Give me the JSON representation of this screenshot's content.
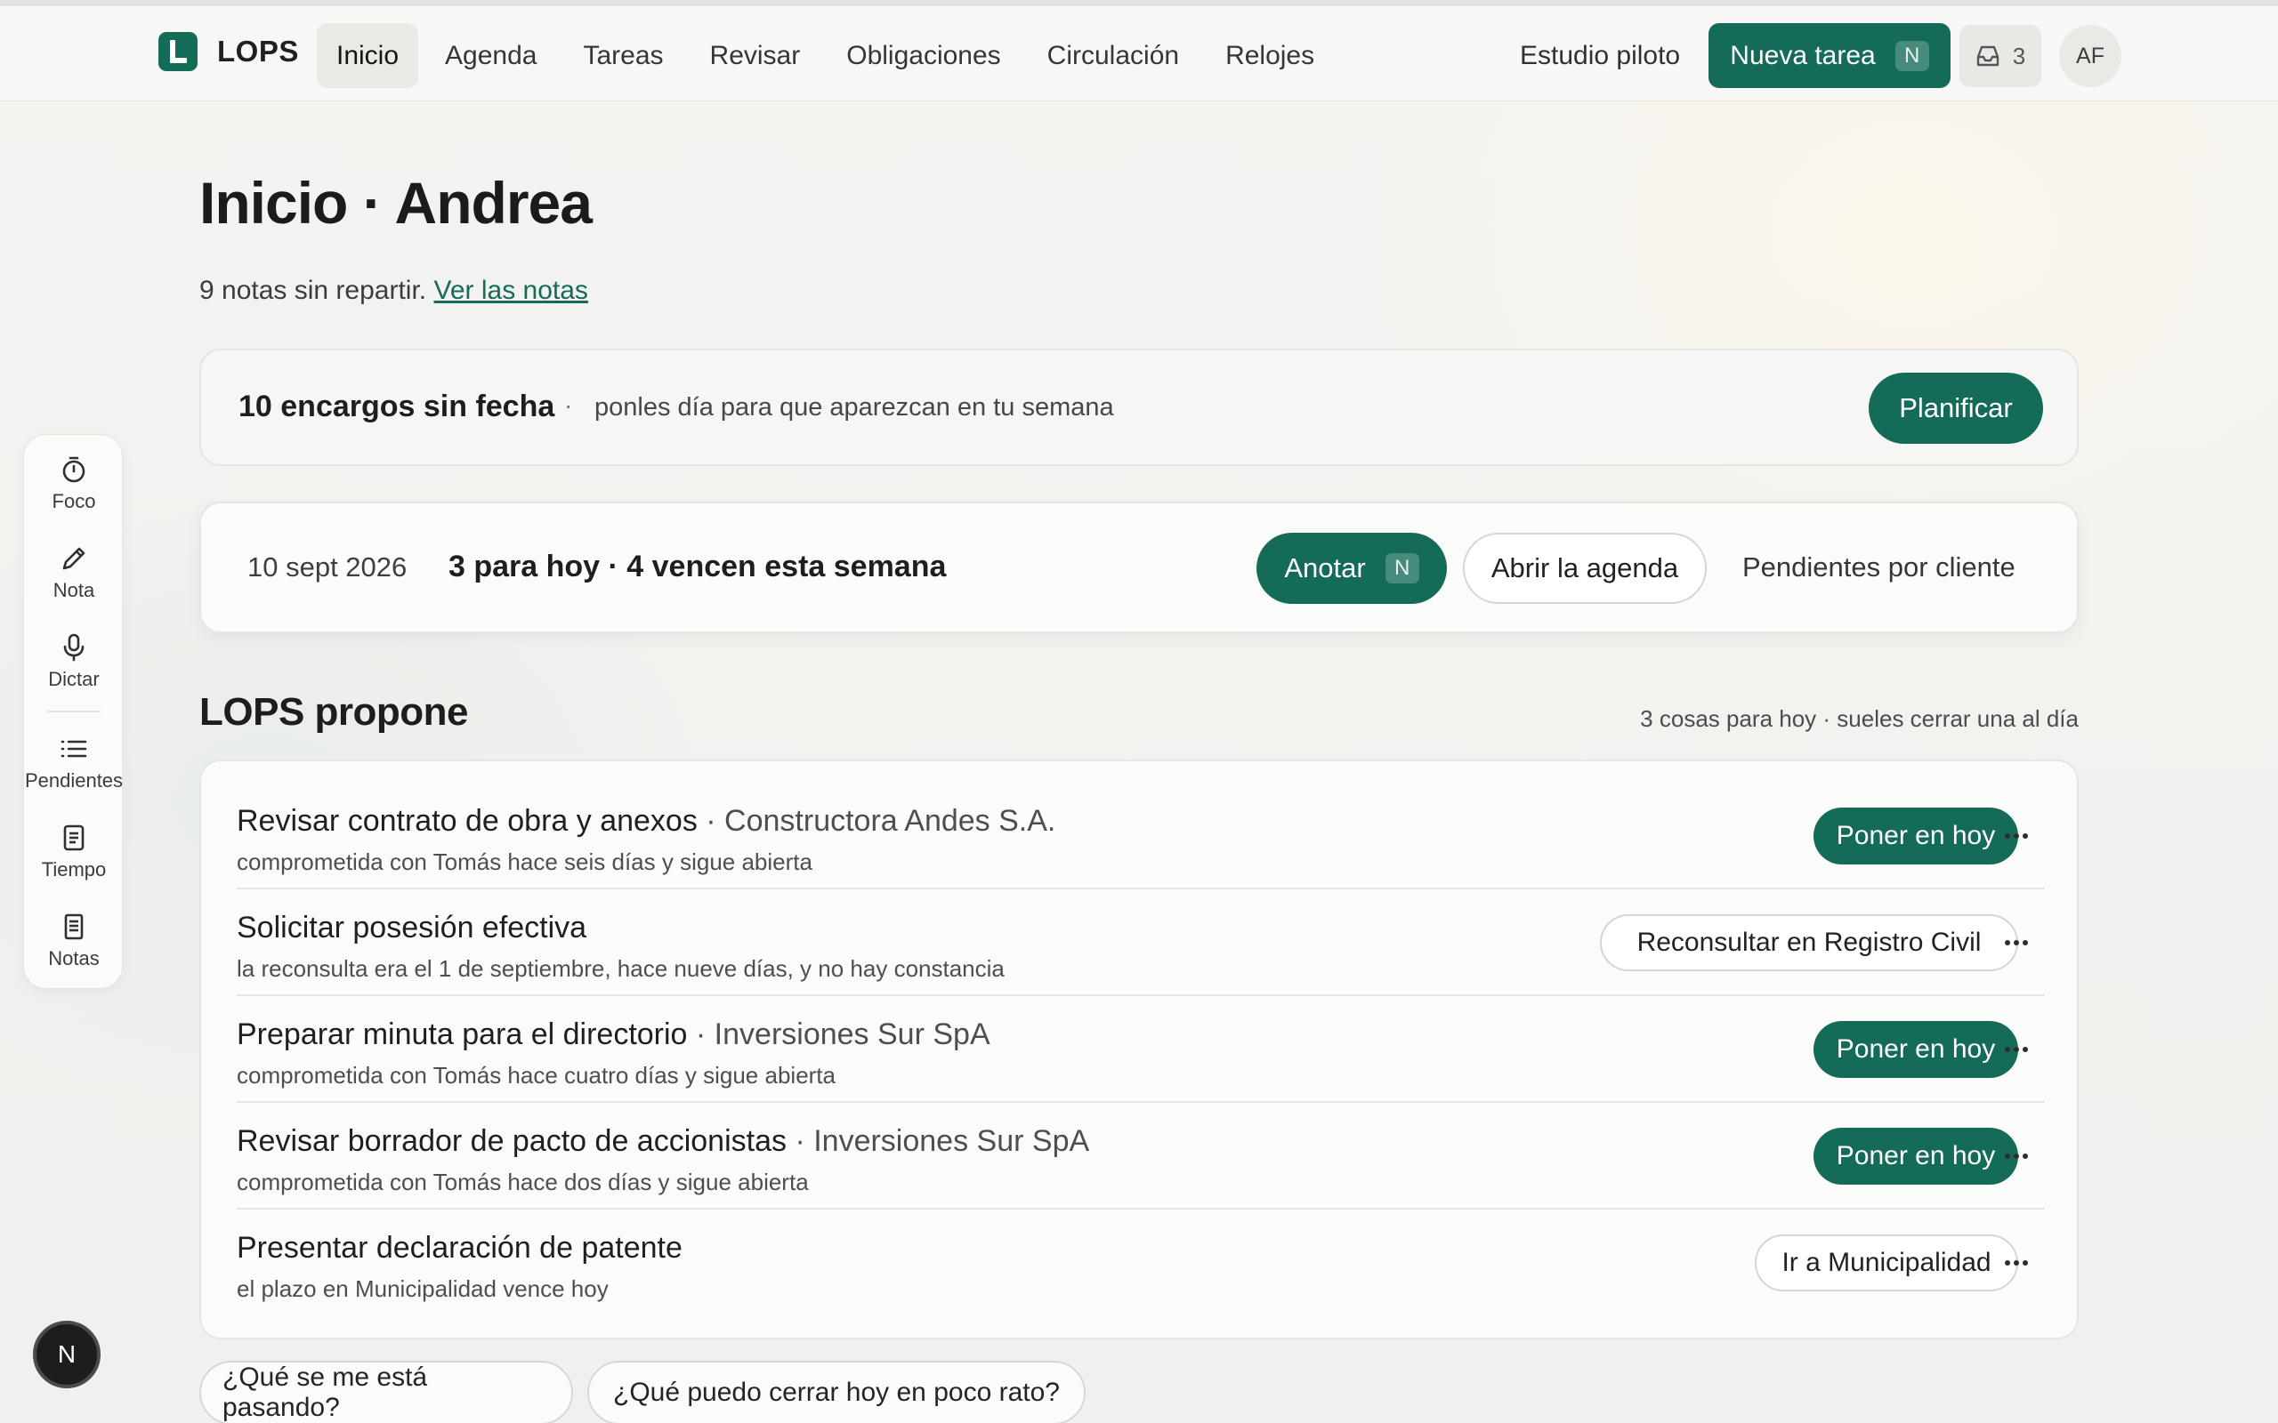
{
  "app": {
    "name": "LOPS"
  },
  "nav": {
    "items": [
      "Inicio",
      "Agenda",
      "Tareas",
      "Revisar",
      "Obligaciones",
      "Circulación",
      "Relojes"
    ],
    "active": "Inicio"
  },
  "header_right": {
    "workspace": "Estudio piloto",
    "new_task_label": "Nueva tarea",
    "new_task_shortcut": "N",
    "inbox_count": "3",
    "avatar_initials": "AF"
  },
  "sidebar": {
    "items": [
      {
        "label": "Foco",
        "icon": "timer-icon"
      },
      {
        "label": "Nota",
        "icon": "pencil-icon"
      },
      {
        "label": "Dictar",
        "icon": "microphone-icon"
      },
      {
        "label": "Pendientes",
        "icon": "list-icon"
      },
      {
        "label": "Tiempo",
        "icon": "document-icon"
      },
      {
        "label": "Notas",
        "icon": "notes-icon"
      }
    ]
  },
  "floating_badge": "N",
  "page": {
    "title": "Inicio · Andrea",
    "notes_text": "9 notas sin repartir.",
    "notes_link": "Ver las notas"
  },
  "unscheduled": {
    "title": "10 encargos sin fecha",
    "separator": "·",
    "hint": "ponles día para que aparezcan en tu semana",
    "button": "Planificar"
  },
  "today_bar": {
    "date": "10 sept 2026",
    "summary": "3 para hoy · 4 vencen esta semana",
    "anotar_label": "Anotar",
    "anotar_shortcut": "N",
    "agenda_button": "Abrir la agenda",
    "by_client_link": "Pendientes por cliente"
  },
  "proposals": {
    "title": "LOPS propone",
    "meta": "3 cosas para hoy · sueles cerrar una al día",
    "rows": [
      {
        "title": "Revisar contrato de obra y anexos",
        "client": " · Constructora Andes S.A.",
        "sub": "comprometida con Tomás hace seis días y sigue abierta",
        "action": "Poner en hoy",
        "action_style": "primary"
      },
      {
        "title": "Solicitar posesión efectiva",
        "client": "",
        "sub": "la reconsulta era el 1 de septiembre, hace nueve días, y no hay constancia",
        "action": "Reconsultar en Registro Civil",
        "action_style": "outline"
      },
      {
        "title": "Preparar minuta para el directorio",
        "client": " · Inversiones Sur SpA",
        "sub": "comprometida con Tomás hace cuatro días y sigue abierta",
        "action": "Poner en hoy",
        "action_style": "primary"
      },
      {
        "title": "Revisar borrador de pacto de accionistas",
        "client": " · Inversiones Sur SpA",
        "sub": "comprometida con Tomás hace dos días y sigue abierta",
        "action": "Poner en hoy",
        "action_style": "primary"
      },
      {
        "title": "Presentar declaración de patente",
        "client": "",
        "sub": "el plazo en Municipalidad vence hoy",
        "action": "Ir a Municipalidad",
        "action_style": "outline"
      }
    ]
  },
  "quick_questions": [
    "¿Qué se me está pasando?",
    "¿Qué puedo cerrar hoy en poco rato?"
  ],
  "colors": {
    "accent": "#136b58",
    "background": "#f1f2ef"
  }
}
